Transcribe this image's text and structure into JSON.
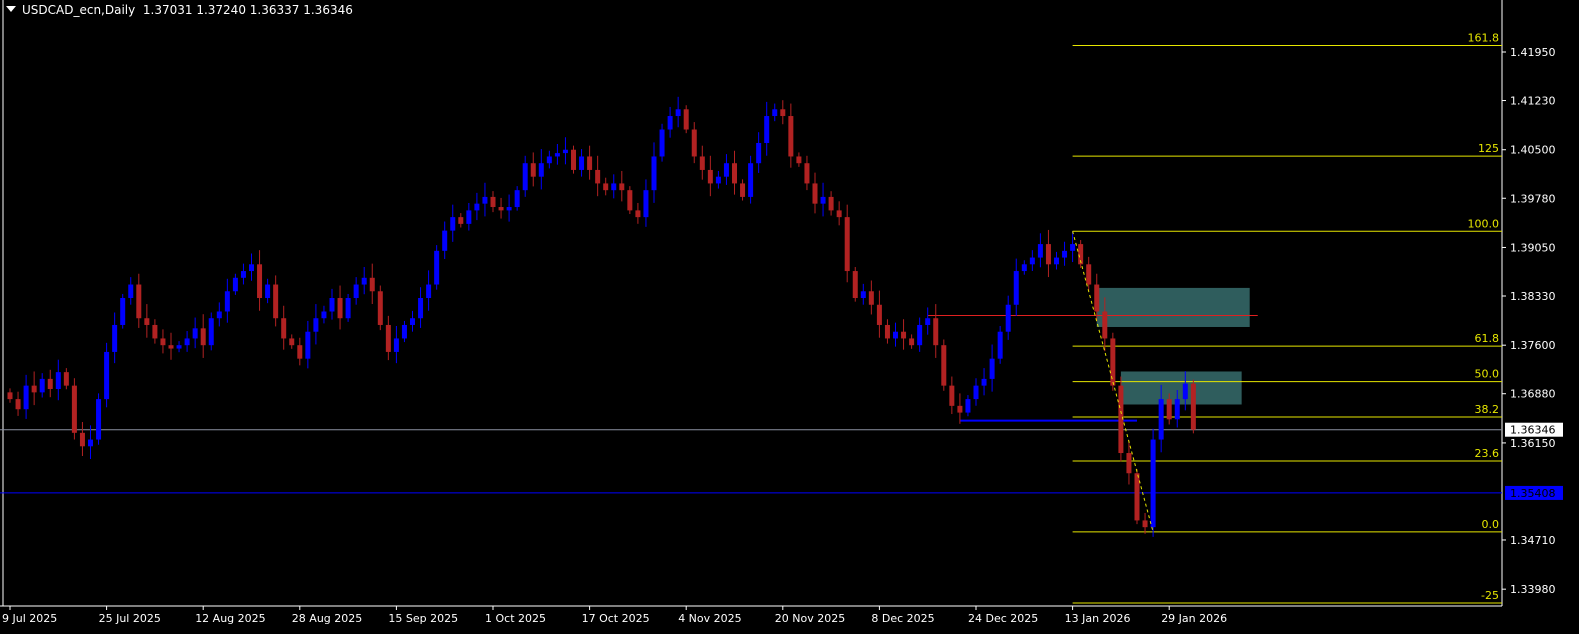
{
  "header": {
    "symbol": "USDCAD_ecn,Daily",
    "open": "1.37031",
    "high": "1.37240",
    "low": "1.36337",
    "close": "1.36346"
  },
  "colors": {
    "bull": "#0000ff",
    "bear": "#b22222",
    "fib": "#e6e600",
    "bid": "#8a8fa0",
    "hline": "#0000ff",
    "red_line": "#e02020",
    "zone": "#2f5d5d"
  },
  "chart_data": {
    "type": "candlestick",
    "title": "USDCAD_ecn,Daily",
    "ylim": [
      1.3365,
      1.4265
    ],
    "price_ticks": [
      "1.41950",
      "1.41230",
      "1.40500",
      "1.39780",
      "1.39050",
      "1.38330",
      "1.37600",
      "1.36880",
      "1.36150",
      "1.34710",
      "1.33980"
    ],
    "date_labels": [
      {
        "bar": 0,
        "label": "9 Jul 2025"
      },
      {
        "bar": 12,
        "label": "25 Jul 2025"
      },
      {
        "bar": 24,
        "label": "12 Aug 2025"
      },
      {
        "bar": 36,
        "label": "28 Aug 2025"
      },
      {
        "bar": 48,
        "label": "15 Sep 2025"
      },
      {
        "bar": 60,
        "label": "1 Oct 2025"
      },
      {
        "bar": 72,
        "label": "17 Oct 2025"
      },
      {
        "bar": 84,
        "label": "4 Nov 2025"
      },
      {
        "bar": 96,
        "label": "20 Nov 2025"
      },
      {
        "bar": 108,
        "label": "8 Dec 2025"
      },
      {
        "bar": 120,
        "label": "24 Dec 2025"
      },
      {
        "bar": 132,
        "label": "13 Jan 2026"
      },
      {
        "bar": 144,
        "label": "29 Jan 2026"
      }
    ],
    "first_open": 1.369,
    "closes": [
      1.368,
      1.3665,
      1.37,
      1.369,
      1.371,
      1.3695,
      1.372,
      1.37,
      1.363,
      1.361,
      1.362,
      1.368,
      1.375,
      1.379,
      1.383,
      1.385,
      1.38,
      1.379,
      1.377,
      1.376,
      1.3755,
      1.376,
      1.377,
      1.3785,
      1.376,
      1.38,
      1.381,
      1.384,
      1.386,
      1.387,
      1.388,
      1.383,
      1.385,
      1.38,
      1.377,
      1.376,
      1.374,
      1.378,
      1.38,
      1.381,
      1.383,
      1.38,
      1.383,
      1.385,
      1.386,
      1.384,
      1.379,
      1.375,
      1.377,
      1.379,
      1.38,
      1.383,
      1.385,
      1.39,
      1.393,
      1.395,
      1.394,
      1.396,
      1.397,
      1.398,
      1.3965,
      1.396,
      1.3965,
      1.399,
      1.403,
      1.401,
      1.403,
      1.404,
      1.4045,
      1.405,
      1.402,
      1.404,
      1.402,
      1.4,
      1.399,
      1.4,
      1.399,
      1.396,
      1.395,
      1.399,
      1.404,
      1.408,
      1.41,
      1.411,
      1.408,
      1.404,
      1.402,
      1.4,
      1.401,
      1.403,
      1.4,
      1.398,
      1.403,
      1.406,
      1.41,
      1.411,
      1.41,
      1.404,
      1.403,
      1.4,
      1.397,
      1.398,
      1.396,
      1.395,
      1.387,
      1.383,
      1.384,
      1.382,
      1.379,
      1.377,
      1.378,
      1.377,
      1.376,
      1.379,
      1.38,
      1.376,
      1.37,
      1.367,
      1.366,
      1.368,
      1.37,
      1.371,
      1.374,
      1.378,
      1.382,
      1.387,
      1.388,
      1.389,
      1.391,
      1.388,
      1.389,
      1.39,
      1.391,
      1.388,
      1.385,
      1.381,
      1.377,
      1.37,
      1.36,
      1.357,
      1.35,
      1.349,
      1.362,
      1.368,
      1.365,
      1.368,
      1.3703,
      1.36346
    ],
    "bid": {
      "value": 1.36346,
      "label": "1.36346"
    },
    "hline": {
      "value": 1.35408,
      "label": "1.35408"
    },
    "red_line": {
      "value": 1.3804,
      "from_bar": 114,
      "to_bar": 155
    },
    "blue_segment": {
      "value": 1.3648,
      "from_bar": 118,
      "to_bar": 140
    },
    "zones": [
      {
        "from_bar": 135,
        "to_bar": 154,
        "top": 1.3845,
        "bottom": 1.3787
      },
      {
        "from_bar": 138,
        "to_bar": 153,
        "top": 1.3721,
        "bottom": 1.3672
      }
    ],
    "trendline": {
      "from_bar": 132,
      "from_price": 1.3929,
      "to_bar": 142,
      "to_price": 1.3483
    },
    "fibonacci": {
      "from_bar": 132,
      "price_0": 1.3483,
      "price_100": 1.3929,
      "levels": [
        {
          "level": 161.8,
          "label": "161.8"
        },
        {
          "level": 125,
          "label": "125"
        },
        {
          "level": 100,
          "label": "100.0"
        },
        {
          "level": 61.8,
          "label": "61.8"
        },
        {
          "level": 50,
          "label": "50.0"
        },
        {
          "level": 38.2,
          "label": "38.2"
        },
        {
          "level": 23.6,
          "label": "23.6"
        },
        {
          "level": 0,
          "label": "0.0"
        },
        {
          "level": -25,
          "label": "-25"
        }
      ]
    }
  }
}
